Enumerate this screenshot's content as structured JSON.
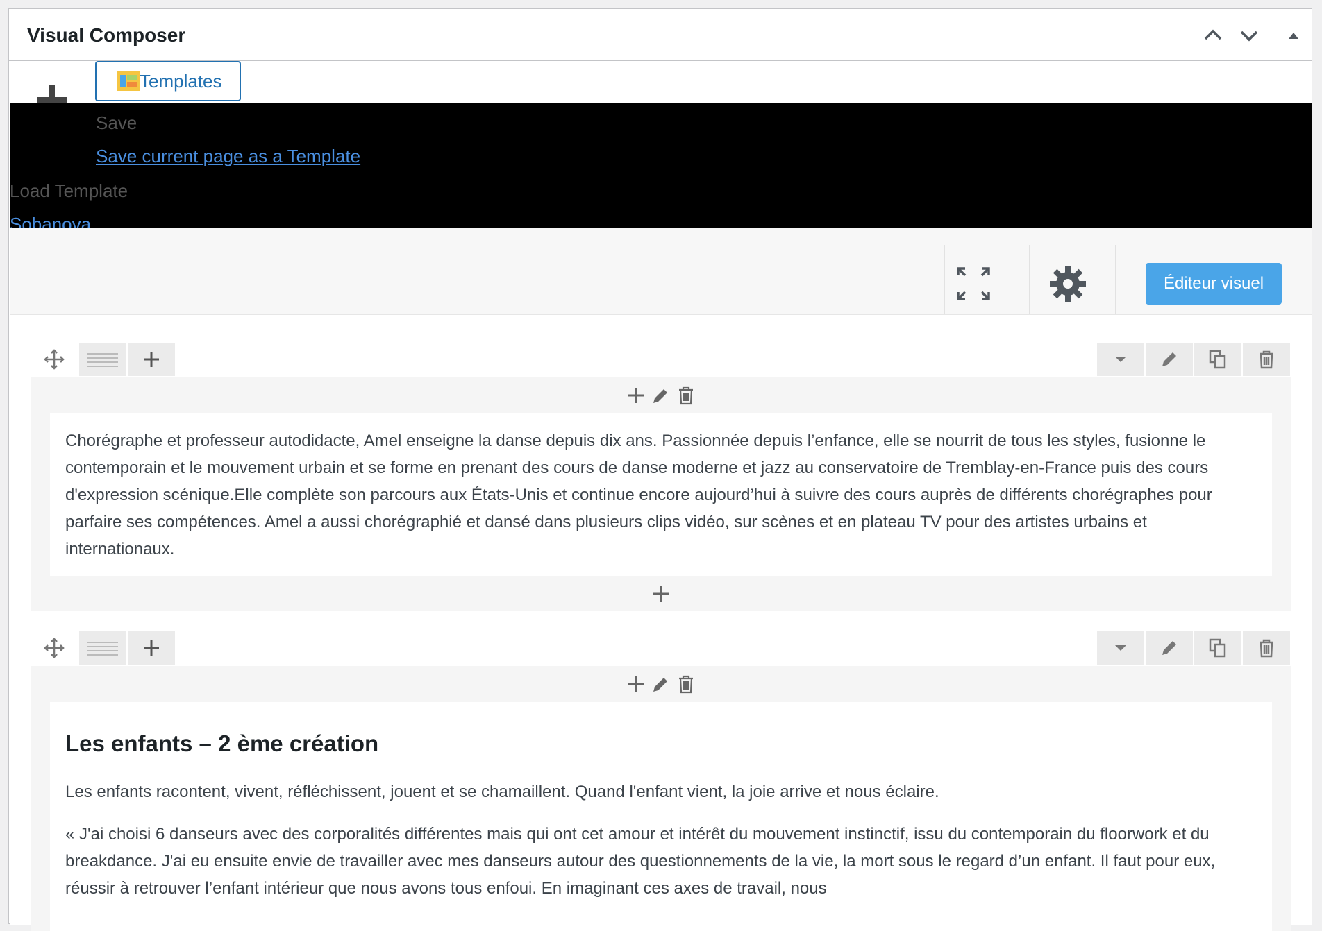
{
  "panel": {
    "title": "Visual Composer",
    "controls": [
      "chevron-up-icon",
      "chevron-down-icon",
      "triangle-up-icon"
    ]
  },
  "toolbar": {
    "templates_label": "Templates",
    "dropdown": {
      "save_heading": "Save",
      "save_link": "Save current page as a Template",
      "load_heading": "Load Template",
      "template_items": [
        "Sobanova"
      ]
    },
    "visual_editor_label": "Éditeur visuel"
  },
  "rows": [
    {
      "paragraphs": [
        "Chorégraphe et professeur autodidacte, Amel enseigne la danse depuis dix ans. Passionnée depuis l’enfance, elle se nourrit de tous les styles, fusionne le contemporain et le mouvement urbain et se forme en prenant des cours de danse moderne et jazz au conservatoire de Tremblay-en-France puis des cours d'expression scénique.Elle complète son parcours aux États-Unis et continue encore aujourd’hui à suivre des cours auprès de différents chorégraphes pour parfaire ses compétences. Amel a aussi chorégraphié et dansé dans plusieurs clips vidéo, sur scènes et en plateau TV pour des artistes urbains et internationaux."
      ]
    },
    {
      "heading": "Les enfants – 2 ème création",
      "paragraphs": [
        "Les enfants racontent, vivent, réfléchissent, jouent et se chamaillent. Quand l'enfant vient, la joie arrive et nous éclaire.",
        "« J'ai choisi 6 danseurs avec des corporalités différentes mais qui ont cet amour et intérêt du mouvement instinctif, issu du contemporain du floorwork et du breakdance. J'ai eu ensuite envie de travailler avec mes danseurs autour des questionnements de la vie, la mort sous le regard d’un enfant. Il faut pour eux, réussir à retrouver l’enfant intérieur que nous avons tous enfoui. En imaginant ces axes de travail, nous"
      ]
    }
  ],
  "colors": {
    "accent": "#2271b1",
    "visual_editor_bg": "#4aa5e8",
    "row_bg": "#f5f5f5"
  }
}
